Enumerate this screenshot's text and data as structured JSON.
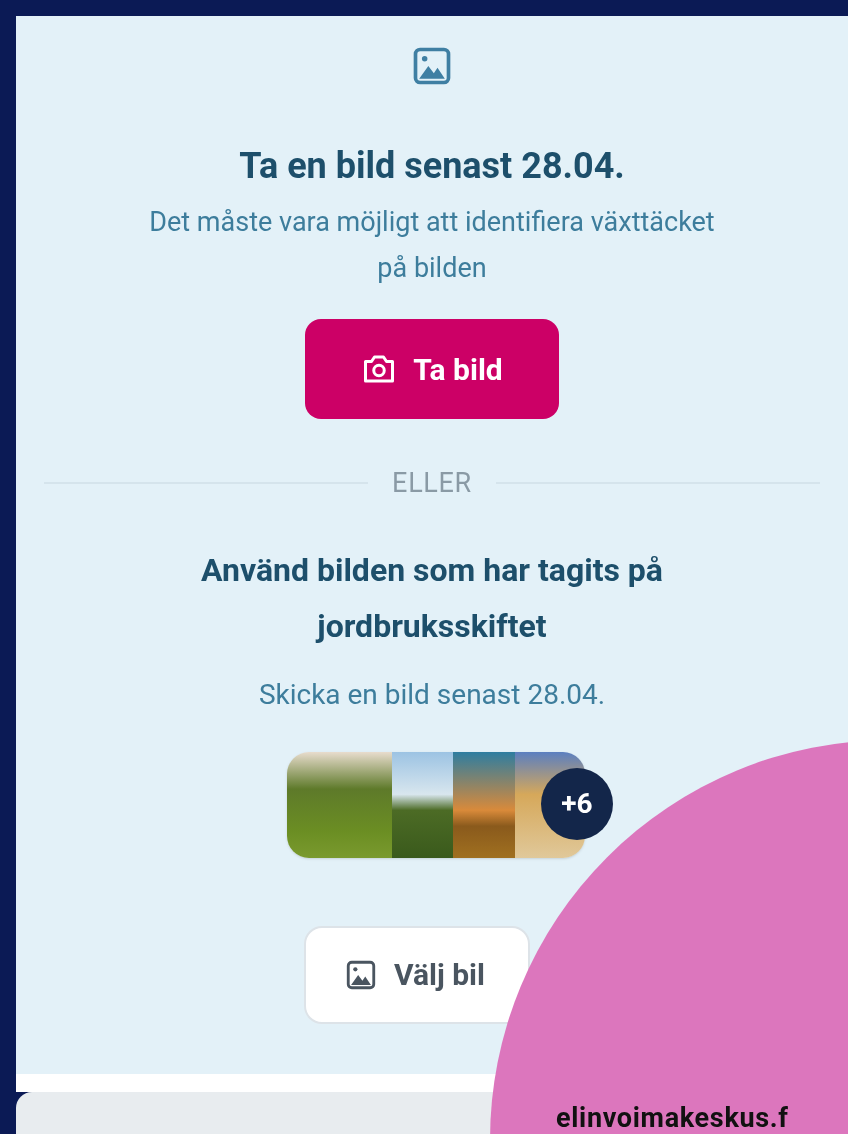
{
  "card": {
    "title": "Ta en bild senast 28.04.",
    "description": "Det måste vara möjligt att identifiera växttäcket på bilden",
    "take_photo_button": "Ta bild",
    "divider_label": "ELLER",
    "alt_title": "Använd bilden som har tagits på jordbruksskiftet",
    "alt_subtitle": "Skicka en bild senast 28.04.",
    "gallery": {
      "more_count": "+6"
    },
    "choose_button": "Välj bil"
  },
  "overlay": {
    "caption": "elinvoimakeskus.f"
  }
}
